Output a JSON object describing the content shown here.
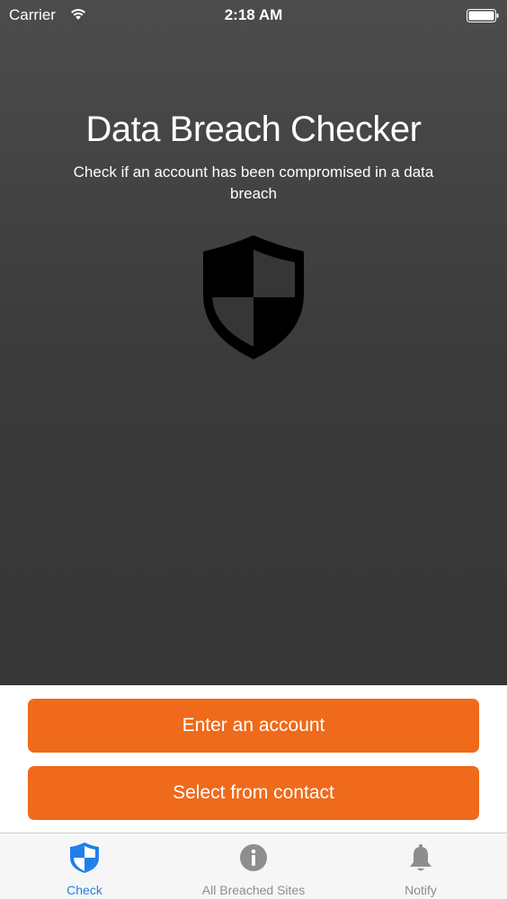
{
  "status_bar": {
    "carrier": "Carrier",
    "time": "2:18 AM"
  },
  "hero": {
    "title": "Data Breach Checker",
    "subtitle": "Check if an account has been compromised in a data breach",
    "icon": "shield-icon"
  },
  "actions": {
    "enter_account_label": "Enter an account",
    "select_contact_label": "Select from contact"
  },
  "tab_bar": {
    "tabs": [
      {
        "label": "Check",
        "icon": "shield-icon",
        "selected": true
      },
      {
        "label": "All Breached Sites",
        "icon": "info-icon",
        "selected": false
      },
      {
        "label": "Notify",
        "icon": "bell-icon",
        "selected": false
      }
    ]
  },
  "colors": {
    "accent": "#ef6a1b",
    "tab_selected": "#1f7fea",
    "tab_unselected": "#8e8e8e"
  }
}
